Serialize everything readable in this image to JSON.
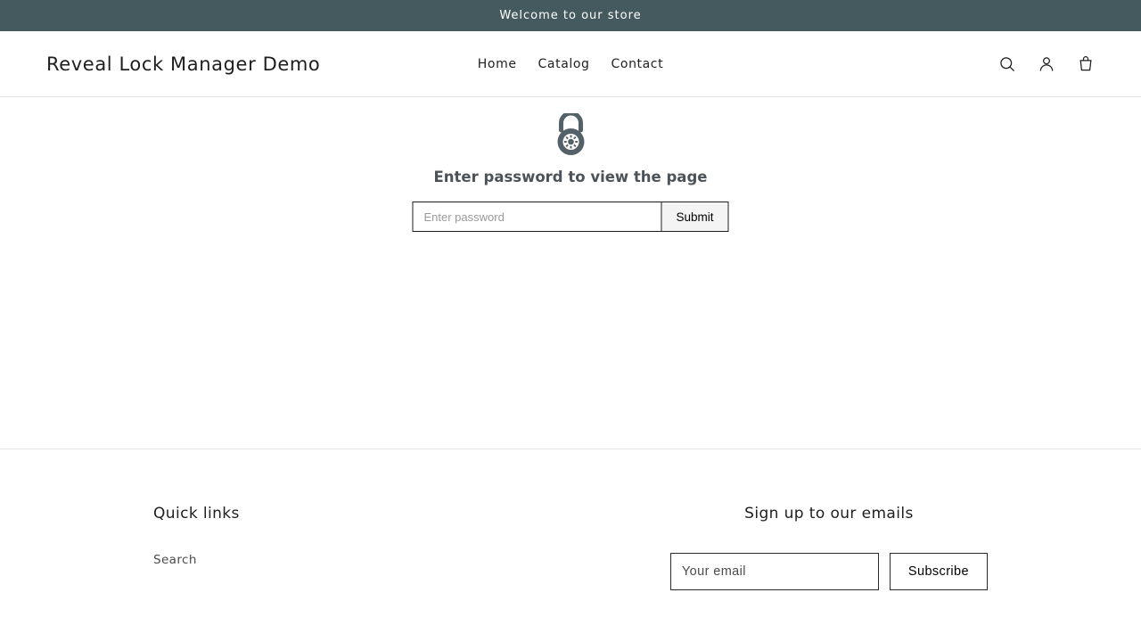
{
  "announcement": {
    "text": "Welcome to our store"
  },
  "header": {
    "brand": "Reveal Lock Manager Demo",
    "nav": [
      "Home",
      "Catalog",
      "Contact"
    ],
    "icons": [
      "search",
      "account",
      "cart"
    ]
  },
  "lock": {
    "heading": "Enter password to view the page",
    "placeholder": "Enter password",
    "submit": "Submit"
  },
  "footer": {
    "quicklinks_heading": "Quick links",
    "quicklinks": [
      "Search"
    ],
    "signup_heading": "Sign up to our emails",
    "email_placeholder": "Your email",
    "subscribe": "Subscribe"
  }
}
